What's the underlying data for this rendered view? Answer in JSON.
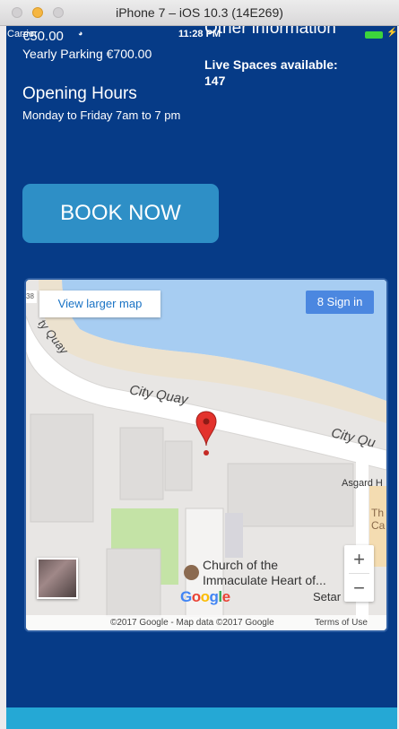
{
  "simulator": {
    "title": "iPhone 7 – iOS 10.3 (14E269)"
  },
  "status_bar": {
    "carrier": "Carrier",
    "time": "11:28 PM"
  },
  "content": {
    "price_partial": "€50.00",
    "yearly_parking": "Yearly Parking €700.00",
    "opening_hours_heading": "Opening Hours",
    "opening_hours_detail": "Monday to Friday 7am to 7 pm",
    "other_info_heading": "Other information",
    "live_spaces": "Live Spaces available: 147",
    "book_button": "BOOK NOW"
  },
  "map": {
    "view_larger": "View larger map",
    "sign_in": "Sign in",
    "street_label": "City Quay",
    "street_label_right": "City Qu",
    "street_label_left": "ty Quay",
    "edge_badge": "38",
    "poi_name_line1": "Church of the",
    "poi_name_line2": "Immaculate Heart of...",
    "asgard": "Asgard H",
    "th_partial": "Th",
    "ca_partial": "Ca",
    "setar": "Setar",
    "zoom_in": "+",
    "zoom_out": "−",
    "logo_letters": [
      "G",
      "o",
      "o",
      "g",
      "l",
      "e"
    ],
    "attribution": "©2017 Google - Map data ©2017 Google",
    "terms": "Terms of Use"
  },
  "colors": {
    "background": "#063b87",
    "button": "#2e8fc6",
    "bottom_bar": "#25a8d5",
    "battery": "#3cd43c"
  }
}
